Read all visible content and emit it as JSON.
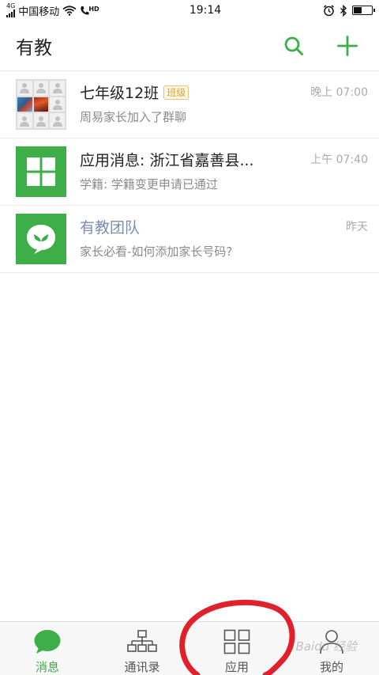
{
  "status_bar": {
    "network": "4G",
    "carrier": "中国移动",
    "hd": "HD",
    "time": "19:14",
    "battery_level": 0.4
  },
  "header": {
    "title": "有教"
  },
  "chats": [
    {
      "name": "七年级12班",
      "badge": "班级",
      "preview": "周易家长加入了群聊",
      "time": "晚上 07:00"
    },
    {
      "name": "应用消息: 浙江省嘉善县...",
      "preview": "学籍: 学籍变更申请已通过",
      "time": "上午 07:40"
    },
    {
      "name": "有教团队",
      "preview": "家长必看-如何添加家长号码?",
      "time": "昨天"
    }
  ],
  "tabs": [
    {
      "label": "消息",
      "active": true
    },
    {
      "label": "通讯录",
      "active": false
    },
    {
      "label": "应用",
      "active": false
    },
    {
      "label": "我的",
      "active": false
    }
  ],
  "watermark": "Baidu 经验",
  "colors": {
    "accent": "#3eae48",
    "team_name": "#7d8bb0",
    "annotation": "#e0202a"
  }
}
